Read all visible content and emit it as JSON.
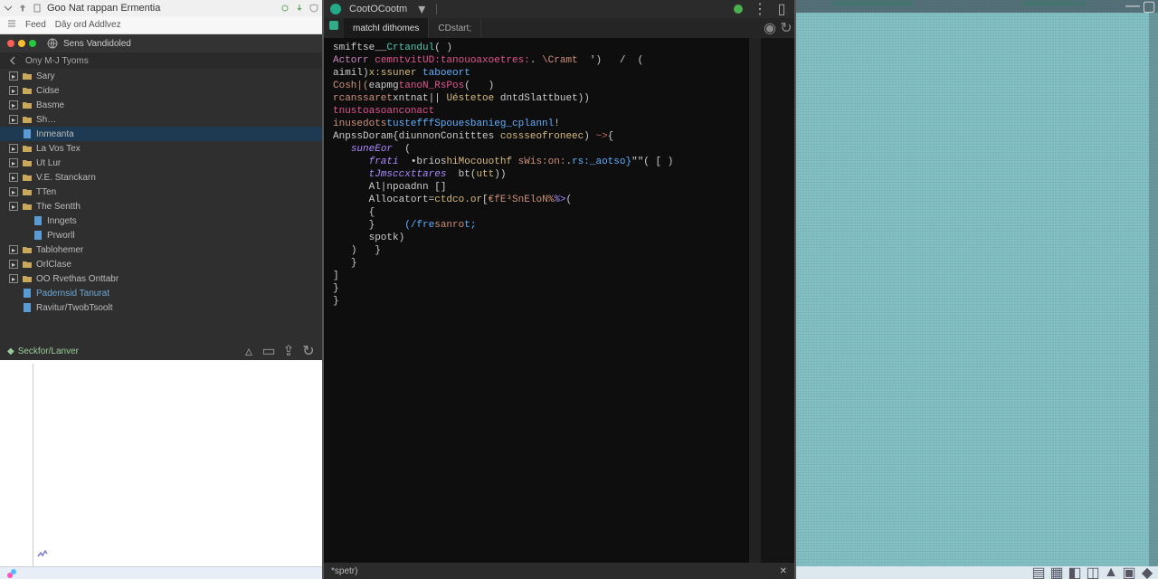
{
  "left": {
    "title": "Goo Nat rappan Ermentia",
    "toolbar": {
      "feed": "Feed",
      "address": "Dây ord Addlvez"
    },
    "account": "Sens Vandidoled",
    "section": "Ony M-J Tyoms",
    "tree": [
      {
        "label": "Sary",
        "folder": true,
        "depth": 0
      },
      {
        "label": "Cidse",
        "folder": true,
        "depth": 0
      },
      {
        "label": "Basme",
        "folder": true,
        "depth": 0
      },
      {
        "label": "Sh…",
        "folder": true,
        "depth": 0
      },
      {
        "label": "Inmeanta",
        "folder": false,
        "depth": 0,
        "selected": true
      },
      {
        "label": "La Vos Tex",
        "folder": true,
        "depth": 0
      },
      {
        "label": "Ut Lur",
        "folder": true,
        "depth": 0
      },
      {
        "label": "V.E. Stanckarn",
        "folder": true,
        "depth": 0
      },
      {
        "label": "TTen",
        "folder": true,
        "depth": 0
      },
      {
        "label": "The Sentth",
        "folder": true,
        "depth": 0
      },
      {
        "label": "Inngets",
        "folder": false,
        "depth": 1
      },
      {
        "label": "Prworll",
        "folder": false,
        "depth": 1
      },
      {
        "label": "Tablohemer",
        "folder": true,
        "depth": 0
      },
      {
        "label": "OrlClase",
        "folder": true,
        "depth": 0
      },
      {
        "label": "OO Rvethas Onttabr",
        "folder": true,
        "depth": 0
      },
      {
        "label": "Padernsid Tanurat",
        "folder": false,
        "depth": 0,
        "accent": true
      },
      {
        "label": "Ravitur/TwobTsoolt",
        "folder": false,
        "depth": 0
      }
    ],
    "status_label": "Seckfor/Lanver"
  },
  "mid": {
    "title": "CootOCootm",
    "tabs": [
      {
        "label": "matchI dithomes",
        "active": true
      },
      {
        "label": "CDstart;",
        "active": false
      }
    ],
    "code": [
      {
        "indent": 0,
        "tokens": [
          [
            "",
            "smiftse__"
          ],
          [
            "ty",
            "Crtandul"
          ],
          [
            "",
            "( )"
          ]
        ]
      },
      {
        "indent": 0,
        "tokens": [
          [
            "tk-pur",
            "Actorr "
          ],
          [
            "hl",
            "cemntvitUD:tanouoaxoetres:"
          ],
          [
            "",
            ". "
          ],
          [
            "str",
            "\\Cramt"
          ],
          [
            "",
            "  ')   /  ("
          ]
        ]
      },
      {
        "indent": 0,
        "tokens": [
          [
            "",
            "aimil)"
          ],
          [
            "fn",
            "x:ssuner "
          ],
          [
            "kw",
            "taboeort"
          ]
        ]
      },
      {
        "indent": 0,
        "tokens": [
          [
            "tk-or",
            "Cosh|("
          ],
          [
            "",
            "eapmg"
          ],
          [
            "hl",
            "tanoN_RsPos"
          ],
          [
            "",
            "(   )"
          ]
        ]
      },
      {
        "indent": 0,
        "tokens": [
          [
            "tk-or",
            "rcanssaret"
          ],
          [
            "",
            "xntnat|"
          ],
          [
            "",
            "| "
          ],
          [
            "fn",
            "Uéstetoe "
          ],
          [
            "",
            "dntdSlattbuet))"
          ]
        ]
      },
      {
        "indent": 0,
        "tokens": [
          [
            "hl",
            "tnustoasoanconact"
          ]
        ]
      },
      {
        "indent": 0,
        "tokens": [
          [
            "tk-or",
            "inusedots"
          ],
          [
            "kw",
            "tustefffSpouesbanieg_cplannl"
          ],
          [
            "",
            "!"
          ]
        ]
      },
      {
        "indent": 0,
        "tokens": [
          [
            "",
            "AnpssDoram{diunnonConitttes "
          ],
          [
            "fn",
            "cossseofroneec"
          ],
          [
            "",
            ") "
          ],
          [
            "op",
            "~>"
          ],
          [
            "",
            "{"
          ]
        ]
      },
      {
        "indent": 1,
        "tokens": [
          [
            "st",
            "suneEor"
          ],
          [
            "",
            "  ("
          ]
        ]
      },
      {
        "indent": 2,
        "tokens": [
          [
            "st",
            "frati  "
          ],
          [
            "",
            "•brios"
          ],
          [
            "fn",
            "hiMocouothf "
          ],
          [
            "tk-or",
            "sWis:on:"
          ],
          [
            "",
            "."
          ],
          [
            "kw",
            "rs:_aotso}"
          ],
          [
            "",
            "\"\"( [ )"
          ]
        ]
      },
      {
        "indent": 2,
        "tokens": [
          [
            "st",
            "tJmsccxttares"
          ],
          [
            "",
            "  bt("
          ],
          [
            "fn",
            "utt"
          ],
          [
            "",
            "))"
          ]
        ]
      },
      {
        "indent": 2,
        "tokens": [
          [
            "",
            "Al|npoadnn []"
          ]
        ]
      },
      {
        "indent": 2,
        "tokens": [
          [
            "",
            "Allocatort="
          ],
          [
            "fn",
            "ctdco.or"
          ],
          [
            "",
            "["
          ],
          [
            "str",
            "€fE³SnEloN%"
          ],
          [
            "st",
            "%>"
          ],
          [
            "",
            "("
          ]
        ]
      },
      {
        "indent": 2,
        "tokens": [
          [
            "",
            "{"
          ]
        ]
      },
      {
        "indent": 2,
        "tokens": [
          [
            "",
            "}     "
          ],
          [
            "kw",
            "(/fre"
          ],
          [
            "tk-or",
            "sanro"
          ],
          [
            "kw",
            "t;"
          ]
        ]
      },
      {
        "indent": 2,
        "tokens": [
          [
            "",
            "spotk)"
          ]
        ]
      },
      {
        "indent": 1,
        "tokens": [
          [
            "",
            ")   }"
          ]
        ]
      },
      {
        "indent": 1,
        "tokens": [
          [
            "",
            "}"
          ]
        ]
      },
      {
        "indent": 0,
        "tokens": [
          [
            "",
            "]"
          ]
        ]
      },
      {
        "indent": 0,
        "tokens": [
          [
            "",
            "}"
          ]
        ]
      },
      {
        "indent": 0,
        "tokens": [
          [
            "",
            "}"
          ]
        ]
      }
    ],
    "status": "*spetr)"
  },
  "right": {
    "status_icons": [
      "a",
      "b",
      "c",
      "d",
      "e",
      "f",
      "g"
    ]
  },
  "icons": {
    "chevron_down": "chevron-down-icon",
    "x": "close-icon",
    "sync": "sync-icon",
    "menu": "menu-icon",
    "gear": "gear-icon",
    "globe": "globe-icon",
    "file": "file-icon",
    "folder": "folder-icon"
  }
}
